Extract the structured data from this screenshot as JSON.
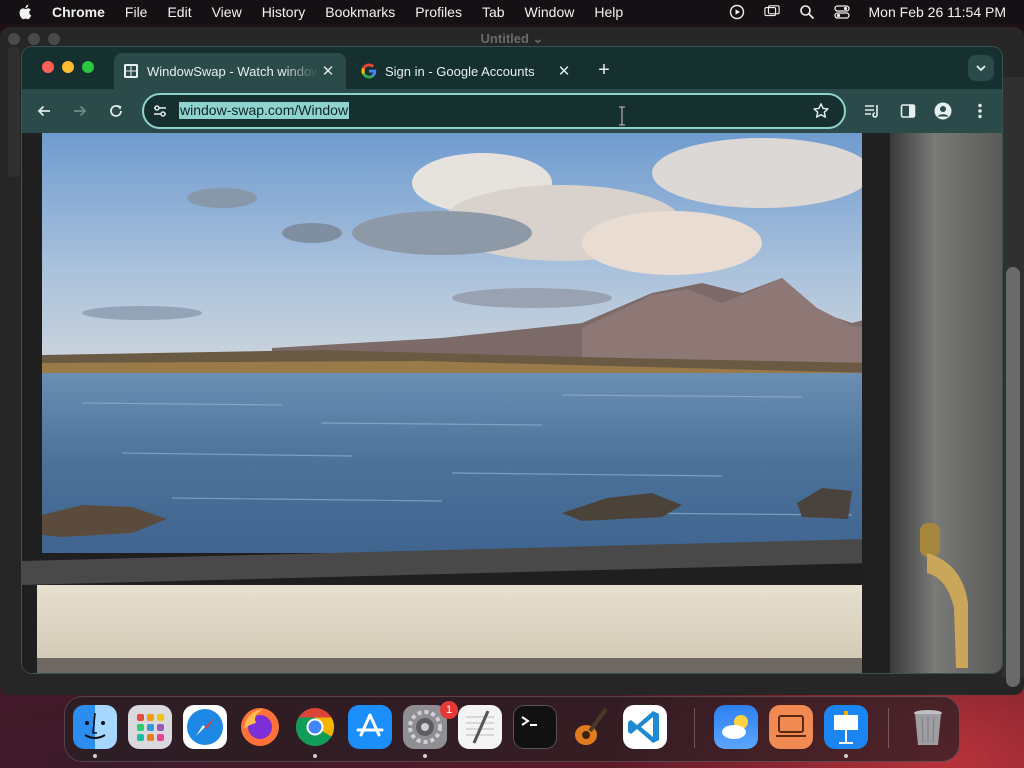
{
  "menubar": {
    "app_name": "Chrome",
    "items": [
      "File",
      "Edit",
      "View",
      "History",
      "Bookmarks",
      "Profiles",
      "Tab",
      "Window",
      "Help"
    ],
    "clock": "Mon Feb 26  11:54 PM",
    "status_icons": [
      "play-circle-icon",
      "screen-mirroring-icon",
      "spotlight-search-icon",
      "control-center-icon"
    ]
  },
  "background_window": {
    "title": "Untitled"
  },
  "browser": {
    "tabs": [
      {
        "title": "WindowSwap - Watch windows around the world",
        "active": true,
        "favicon": "windowswap-favicon"
      },
      {
        "title": "Sign in - Google Accounts",
        "active": false,
        "favicon": "google-favicon"
      }
    ],
    "omnibox": {
      "url": "window-swap.com/Window",
      "selected": true
    },
    "toolbar_icons": [
      "back-icon",
      "forward-icon",
      "reload-icon",
      "site-info-icon",
      "bookmark-star-icon",
      "reading-list-icon",
      "side-panel-icon",
      "profile-icon",
      "menu-icon"
    ]
  },
  "content": {
    "description_none": ""
  },
  "dock": {
    "apps": [
      {
        "name": "Finder",
        "icon": "finder-icon",
        "running": true
      },
      {
        "name": "Launchpad",
        "icon": "launchpad-icon",
        "running": false
      },
      {
        "name": "Safari",
        "icon": "safari-icon",
        "running": false
      },
      {
        "name": "Firefox",
        "icon": "firefox-icon",
        "running": false
      },
      {
        "name": "Google Chrome",
        "icon": "chrome-icon",
        "running": true
      },
      {
        "name": "App Store",
        "icon": "app-store-icon",
        "running": false
      },
      {
        "name": "System Settings",
        "icon": "system-settings-icon",
        "running": true,
        "badge": "1"
      },
      {
        "name": "TextEdit",
        "icon": "textedit-icon",
        "running": false
      },
      {
        "name": "Terminal",
        "icon": "terminal-icon",
        "running": false
      },
      {
        "name": "GarageBand",
        "icon": "garageband-icon",
        "running": false
      },
      {
        "name": "Visual Studio Code",
        "icon": "vscode-icon",
        "running": false
      },
      {
        "name": "Weather",
        "icon": "weather-icon",
        "running": false
      },
      {
        "name": "Presentation",
        "icon": "presentation-app-icon",
        "running": false
      },
      {
        "name": "Keynote",
        "icon": "keynote-icon",
        "running": true
      },
      {
        "name": "Trash",
        "icon": "trash-icon",
        "running": false
      }
    ]
  },
  "colors": {
    "tab_strip": "#16302f",
    "toolbar": "#2b4b4a",
    "omnibox_focus": "#8fd3cf",
    "badge": "#e53935"
  }
}
